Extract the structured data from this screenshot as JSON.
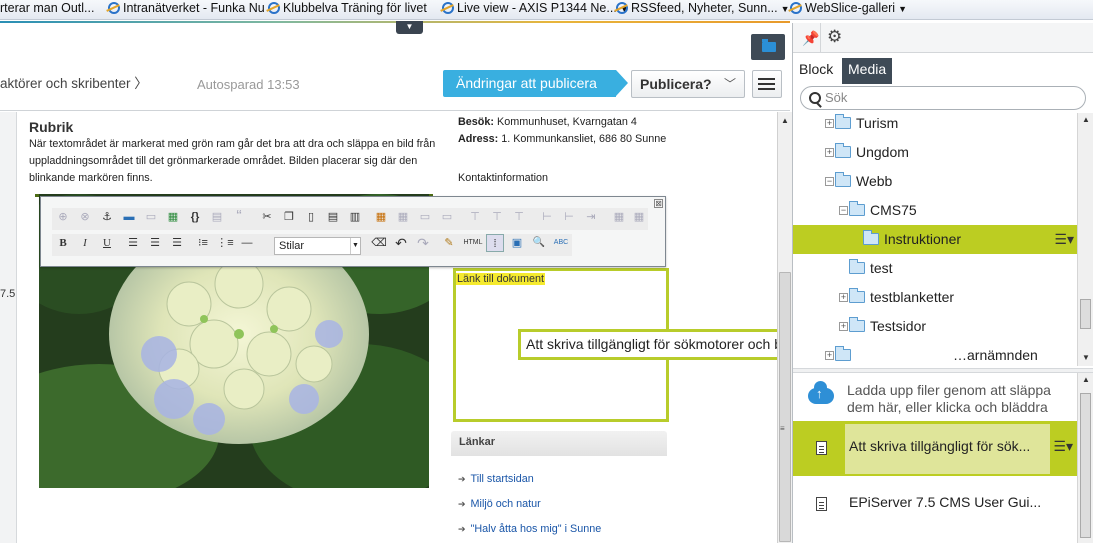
{
  "favorites": [
    {
      "label": "rterar man Outl...",
      "has_caret": false
    },
    {
      "label": "Intranätverket - Funka Nu",
      "has_caret": false
    },
    {
      "label": "Klubbelva  Träning för livet",
      "has_caret": false
    },
    {
      "label": "Live view - AXIS P1344 Ne...",
      "has_caret": true
    },
    {
      "label": "RSSfeed, Nyheter, Sunn...",
      "has_caret": true
    },
    {
      "label": "WebSlice-galleri",
      "has_caret": true
    }
  ],
  "toolbar": {
    "breadcrumb": "aktörer och skribenter 〉",
    "autosave": "Autosparad 13:53",
    "changes_label": "Ändringar att publicera",
    "publish_label": "Publicera?",
    "publish_chevron": "﹀"
  },
  "content": {
    "heading": "Rubrik",
    "intro": "När textområdet är markerat med grön ram går det bra att dra och släppa en bild från uppladdningsområdet till det grönmarkerade området. Bilden placerar sig där den blinkande markören finns.",
    "side_number": "7.5",
    "visit_label": "Besök:",
    "visit_text": " Kommunhuset, Kvarngatan 4",
    "address_label": "Adress:",
    "address_text": " 1. Kommunkansliet, 686 80 Sunne",
    "contact": "Kontaktinformation",
    "doc_link": "Länk till dokument",
    "links_heading": "Länkar",
    "links": [
      "Till startsidan",
      "Miljö och natur",
      "\"Halv åtta hos mig\" i Sunne"
    ]
  },
  "editor": {
    "style_select": "Stilar",
    "close": "⊠",
    "row1_icons": [
      "link-icon",
      "unlink-icon",
      "anchor-icon",
      "image-icon",
      "edit-image-icon",
      "insert-template-icon",
      "code-icon",
      "dynamic-content-icon",
      "quote-icon",
      "cut-icon",
      "copy-icon",
      "paste-icon",
      "paste-text-icon",
      "paste-word-icon",
      "insert-table-icon",
      "table-props-icon",
      "row-props-icon",
      "cell-props-icon",
      "insert-row-icon",
      "delete-row-icon",
      "insert-col-icon",
      "delete-col-icon",
      "split-cell-icon",
      "merge-cell-icon"
    ],
    "row2_icons": [
      "bold-icon",
      "italic-icon",
      "underline-icon",
      "align-left-icon",
      "align-center-icon",
      "align-right-icon",
      "bullet-list-icon",
      "numbered-list-icon",
      "horizontal-rule-icon",
      "clear-format-icon",
      "undo-icon",
      "redo-icon",
      "cleanup-icon",
      "html-icon",
      "toggle-visual-icon",
      "fullscreen-icon",
      "search-icon",
      "spellcheck-icon"
    ],
    "glyphs": {
      "bold": "B",
      "italic": "I",
      "underline": "U",
      "html": "HTML",
      "quote": "“",
      "code": "{}",
      "cut": "✂",
      "undo": "↶",
      "redo": "↷",
      "search": "🔍",
      "spell": "ABC"
    }
  },
  "tooltip": "Att skriva tillgängligt för sökmotorer och besökare (Sunne).pdf",
  "panel": {
    "tab_block": "Block",
    "tab_media": "Media",
    "search_placeholder": "Sök",
    "tree": [
      {
        "label": "Turism",
        "expander": "+",
        "level": 0,
        "selected": false
      },
      {
        "label": "Ungdom",
        "expander": "+",
        "level": 0,
        "selected": false
      },
      {
        "label": "Webb",
        "expander": "−",
        "level": 0,
        "selected": false
      },
      {
        "label": "CMS75",
        "expander": "−",
        "level": 1,
        "selected": false
      },
      {
        "label": "Instruktioner",
        "expander": "",
        "level": 2,
        "selected": true
      },
      {
        "label": "test",
        "expander": "",
        "level": 1,
        "selected": false
      },
      {
        "label": "testblanketter",
        "expander": "+",
        "level": 1,
        "selected": false
      },
      {
        "label": "Testsidor",
        "expander": "+",
        "level": 1,
        "selected": false
      },
      {
        "label": "…arnämnden",
        "expander": "+",
        "level": 0,
        "selected": false
      }
    ],
    "upload_text": "Ladda upp filer genom att släppa dem här, eller klicka och bläddra",
    "media_items": [
      {
        "label": "Att skriva tillgängligt för sök...",
        "selected": true
      },
      {
        "label": "EPiServer 7.5 CMS User Gui...",
        "selected": false
      }
    ],
    "item_menu": "☰▾"
  }
}
